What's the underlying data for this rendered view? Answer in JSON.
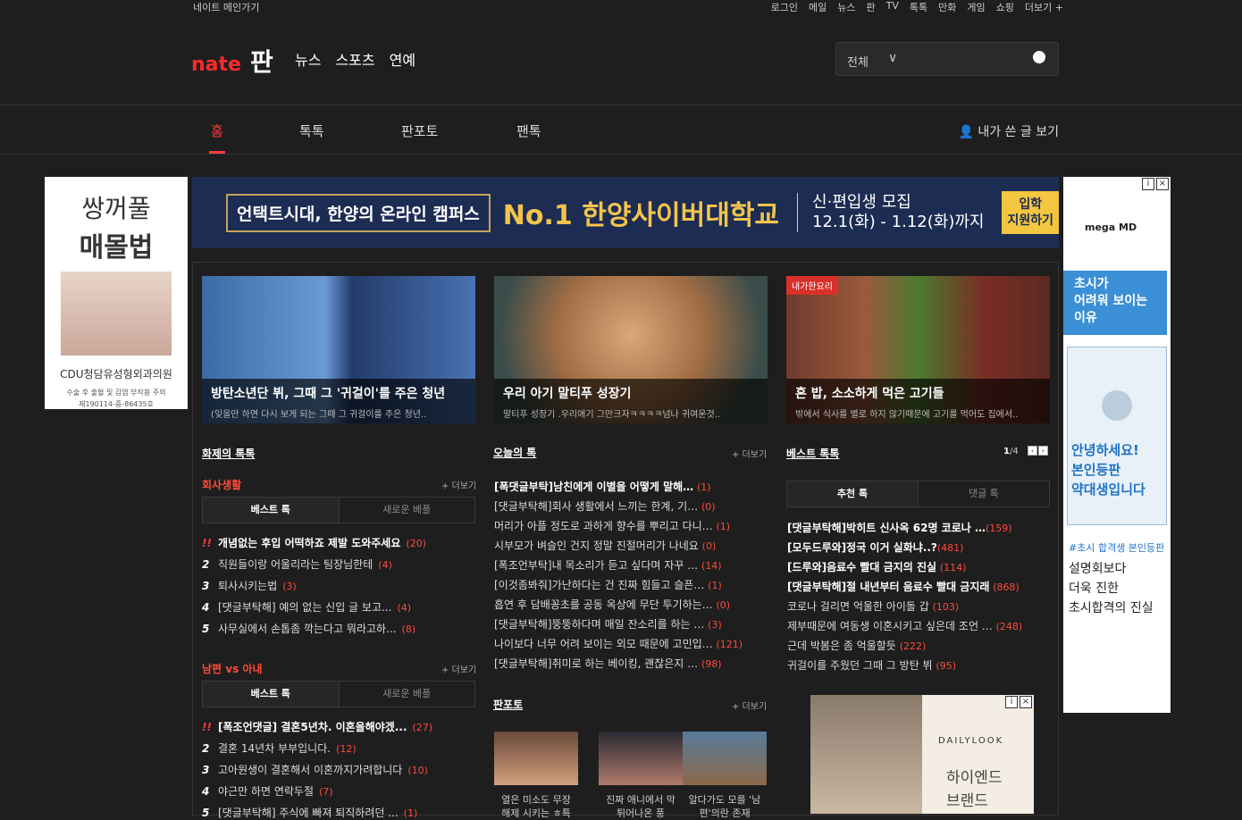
{
  "topbar": {
    "home_link": "네이트 메인가기",
    "links": [
      "로그인",
      "메일",
      "뉴스",
      "판",
      "TV",
      "톡톡",
      "만화",
      "게임",
      "쇼핑",
      "더보기 +"
    ]
  },
  "header": {
    "logo_nate": "nate",
    "logo_pan": "판",
    "nav": [
      "뉴스",
      "스포츠",
      "연예"
    ],
    "search_scope": "전체"
  },
  "navbar": {
    "tabs": [
      "홈",
      "톡톡",
      "판포토",
      "팬톡"
    ],
    "my_posts": "내가 쓴 글 보기"
  },
  "left_ad": {
    "line1": "쌍꺼풀",
    "line2": "매몰법",
    "clinic": "CDU청담유성형외과의원",
    "notice1": "수술 후 출혈 및 감염 부작용 주의",
    "notice2": "제190114-중-86435호"
  },
  "banner": {
    "slogan": "언택트시대, 한양의 온라인 캠퍼스",
    "title": "No.1 한양사이버대학교",
    "recruit1": "신·편입생 모집",
    "recruit2": "12.1(화) - 1.12(화)까지",
    "cta1": "입학",
    "cta2": "지원하기"
  },
  "cards": [
    {
      "title": "방탄소년단 뷔, 그때 그 '귀걸이'를 주은 청년",
      "sub": "(잊을만 하면 다시 보게 되는 그때 그 귀걸이를 주은 청년..",
      "tag": ""
    },
    {
      "title": "우리 아기 말티푸 성장기",
      "sub": "말티푸 성장기 .우리애기 그만크자ㅋㅋㅋㅋ넘나 귀여운것..",
      "tag": ""
    },
    {
      "title": "혼 밥, 소소하게 먹은 고기들",
      "sub": "밖에서 식사를 별로 하지 않기때문에 고기를 먹어도 집에서..",
      "tag": "내가한요리"
    }
  ],
  "hot": {
    "title": "화제의 톡톡",
    "cat1": {
      "name": "회사생활",
      "more": "+ 더보기",
      "tab_on": "베스트 톡",
      "tab_off": "새로운 베플",
      "items": [
        {
          "n": "!!",
          "t": "개념없는 후입 어떡하죠 제발 도와주세요",
          "c": "(20)"
        },
        {
          "n": "2",
          "t": "직원들이랑 어울리라는 팀장님한테",
          "c": "(4)"
        },
        {
          "n": "3",
          "t": "퇴사시키는법",
          "c": "(3)"
        },
        {
          "n": "4",
          "t": "[댓글부탁해] 예의 없는 신입 글 보고...",
          "c": "(4)"
        },
        {
          "n": "5",
          "t": "사무실에서 손톱좀 깍는다고 뭐라고하...",
          "c": "(8)"
        }
      ]
    },
    "cat2": {
      "name": "남편 vs 아내",
      "more": "+ 더보기",
      "tab_on": "베스트 톡",
      "tab_off": "새로운 베플",
      "items": [
        {
          "n": "!!",
          "t": "[폭조언댓글] 결혼5년차. 이혼을해야겠...",
          "c": "(27)"
        },
        {
          "n": "2",
          "t": "결혼 14년차 부부입니다.",
          "c": "(12)"
        },
        {
          "n": "3",
          "t": "고아원생이 결혼해서 이혼까지가려합니다",
          "c": "(10)"
        },
        {
          "n": "4",
          "t": "야근만 하면 연락두절",
          "c": "(7)"
        },
        {
          "n": "5",
          "t": "[댓글부탁해] 주식에 빠져 퇴직하려던 ...",
          "c": "(1)"
        }
      ]
    }
  },
  "today": {
    "title": "오늘의 톡",
    "more": "+ 더보기",
    "items": [
      {
        "t": "[폭댓글부탁]남친에게 이별을 어떻게 말해…",
        "c": "(1)"
      },
      {
        "t": "[댓글부탁해]회사 생활에서 느끼는 한계, 기…",
        "c": "(0)"
      },
      {
        "t": "머리가 아플 정도로 과하게 향수를 뿌리고 다니…",
        "c": "(1)"
      },
      {
        "t": "시부모가 벼슬인 건지 정말 진절머리가 나네요",
        "c": "(0)"
      },
      {
        "t": "[폭조언부탁]내 목소리가 듣고 싶다며 자꾸 …",
        "c": "(14)"
      },
      {
        "t": "[이것좀봐줘]가난하다는 건 진짜 힘들고 슬픈…",
        "c": "(1)"
      },
      {
        "t": "흡연 후 담배꽁초를 공동 옥상에 무단 투기하는…",
        "c": "(0)"
      },
      {
        "t": "[댓글부탁해]뚱뚱하다며 매일 잔소리를 하는 …",
        "c": "(3)"
      },
      {
        "t": "나이보다 너무 어려 보이는 외모 때문에 고민입…",
        "c": "(121)"
      },
      {
        "t": "[댓글부탁해]취미로 하는 베이킹, 괜찮은지 …",
        "c": "(98)"
      }
    ]
  },
  "photo": {
    "title": "판포토",
    "more": "+ 더보기",
    "items": [
      {
        "l1": "열은 미소도 무장",
        "l2": "해제 시키는 ㅎ특"
      },
      {
        "l1": "진짜 애니에서 막",
        "l2": "튀어나온 풍"
      },
      {
        "l1": "알다가도 모를 '남",
        "l2": "편'의란 존재"
      }
    ]
  },
  "best": {
    "title": "베스트 톡톡",
    "page": "1",
    "total": "/4",
    "tab_on": "추천 톡",
    "tab_off": "댓글 톡",
    "items": [
      {
        "t": "[댓글부탁해]박히트 신사옥 62명 코로나 …",
        "c": "(159)"
      },
      {
        "t": "[모두드루와]정국 이거 실화냐..?",
        "c": "(481)"
      },
      {
        "t": "[드루와]음료수 빨대 금지의 진실",
        "c": "(114)"
      },
      {
        "t": "[댓글부탁해]절 내년부터 음료수 빨대 금지래",
        "c": "(868)"
      },
      {
        "t": "코로나 걸리면 억울한 아이돌 갑",
        "c": "(103)"
      },
      {
        "t": "제부때문에 여동생 이혼시키고 싶은데 조언 …",
        "c": "(248)"
      },
      {
        "t": "근데 박봄은 좀 억울할듯",
        "c": "(222)"
      },
      {
        "t": "귀걸이를 주웠던 그때 그 방탄 뷔",
        "c": "(95)"
      }
    ]
  },
  "right_ad": {
    "brand": "mega MD",
    "l1": "초시가",
    "l2": "어려워 보이는",
    "l3": "이유",
    "v1": "안녕하세요!",
    "v2": "본인등판",
    "v3": "약대생입니다",
    "hash": "#초시 합격생 본인등판",
    "d1": "설명회보다",
    "d2": "더욱 진한",
    "d3": "초시합격의 진실"
  },
  "bottom_ad": {
    "brand": "DAILYLOOK",
    "l1": "하이엔드",
    "l2": "브랜드"
  }
}
